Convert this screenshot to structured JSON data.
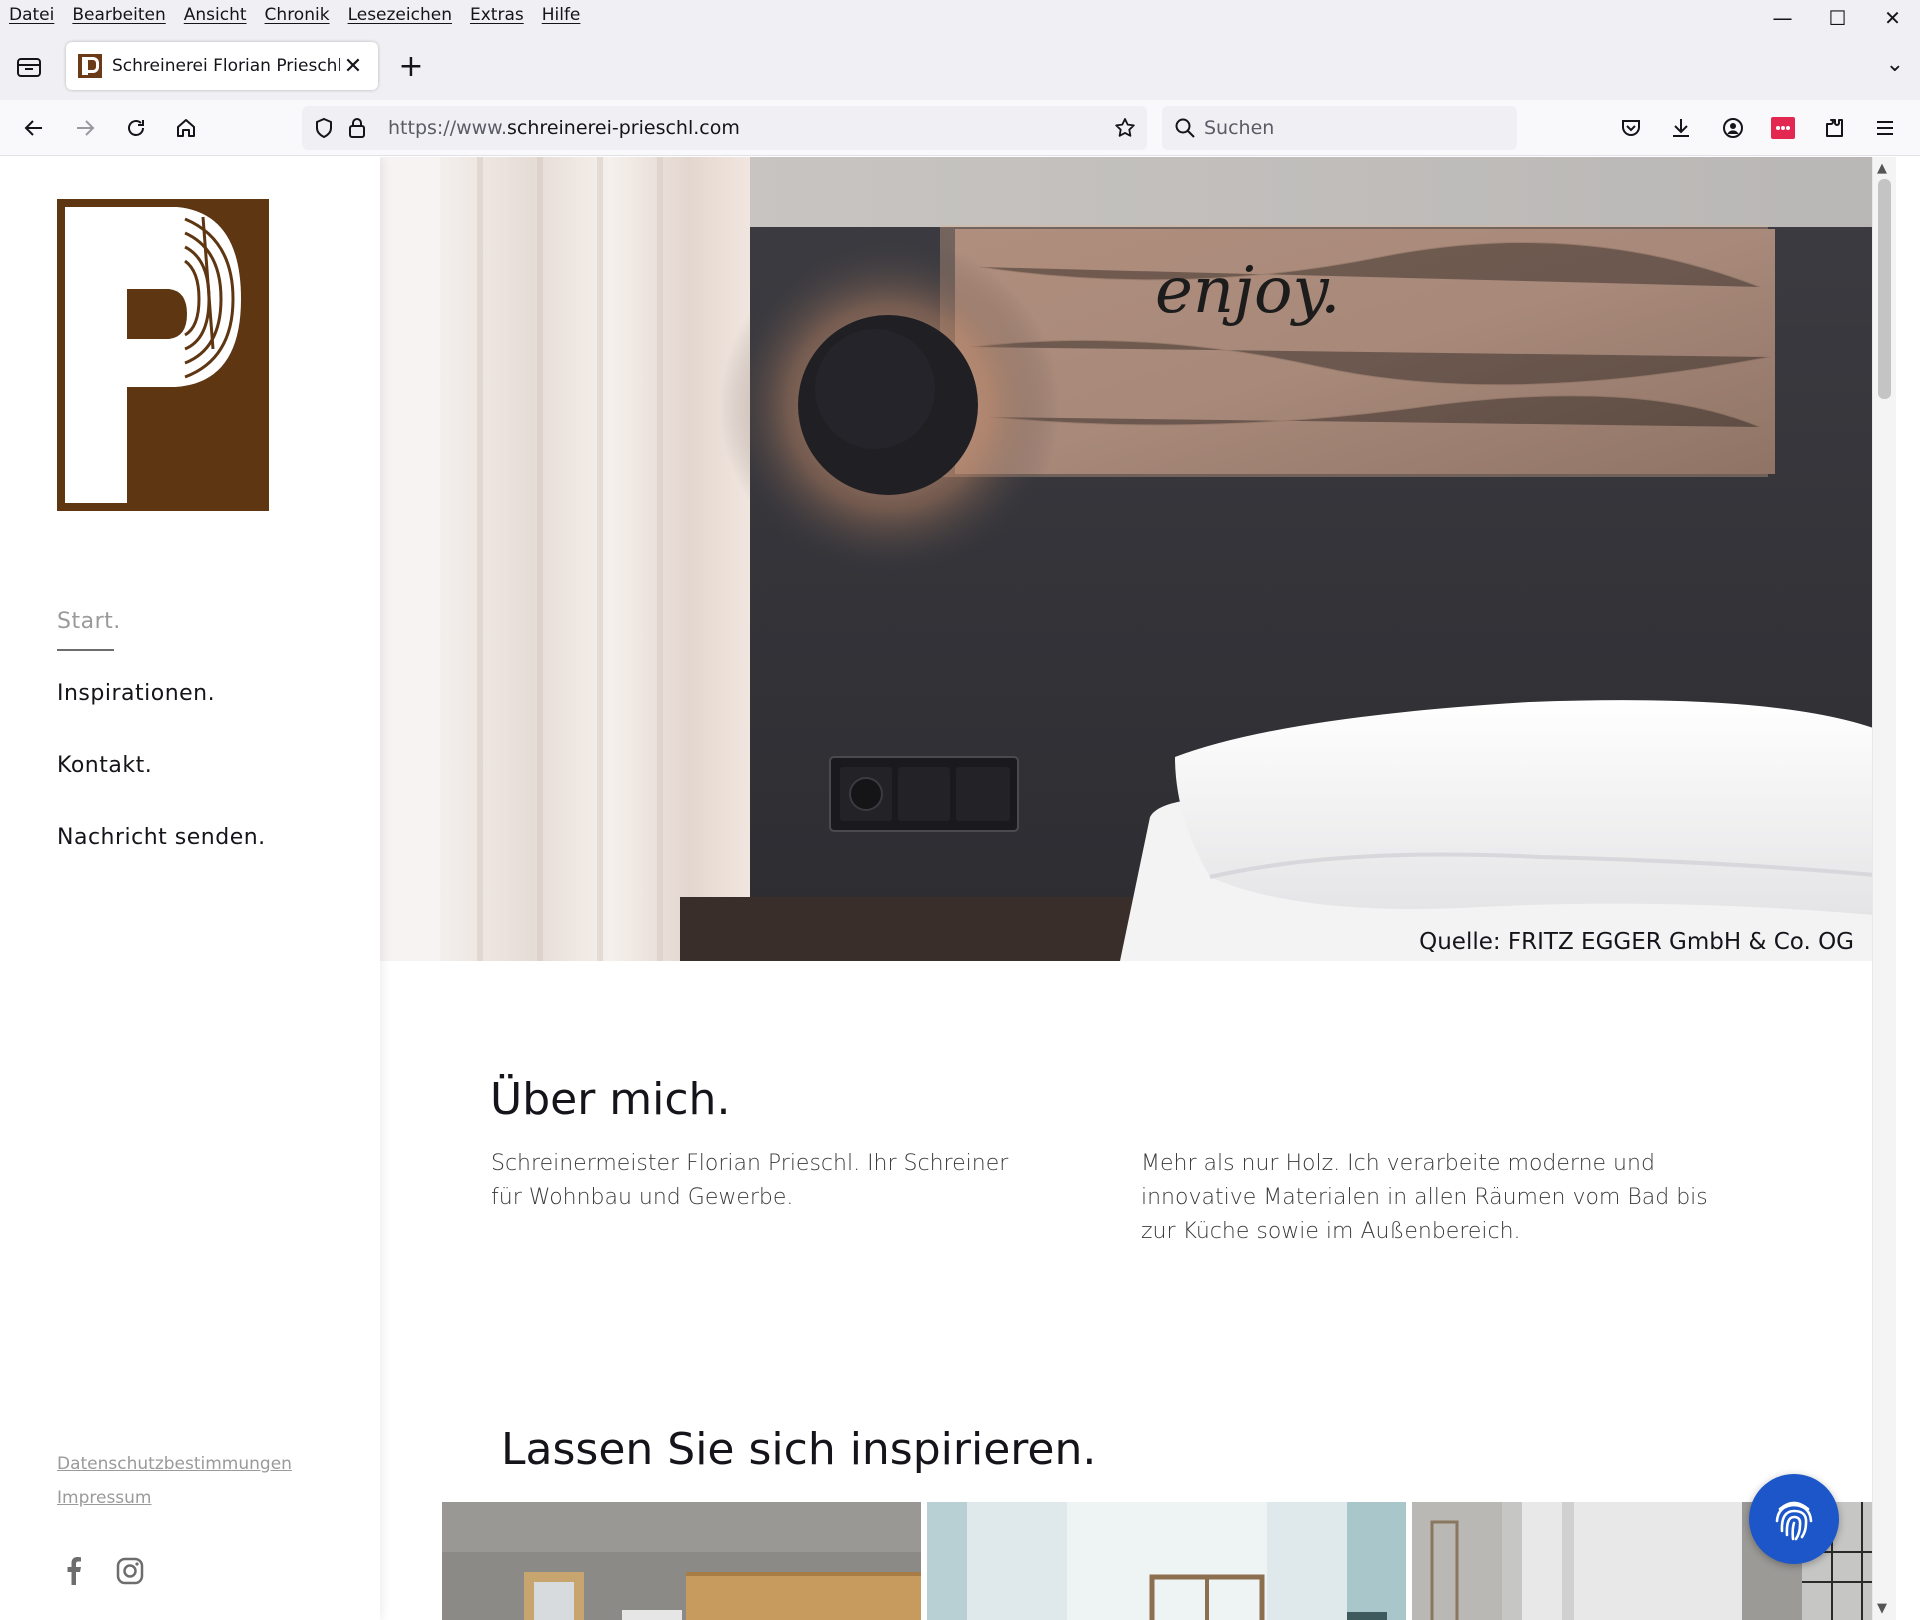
{
  "menubar": {
    "items": [
      "Datei",
      "Bearbeiten",
      "Ansicht",
      "Chronik",
      "Lesezeichen",
      "Extras",
      "Hilfe"
    ]
  },
  "window_controls": {
    "minimize": "—",
    "maximize": "☐",
    "close": "✕"
  },
  "tab": {
    "title": "Schreinerei Florian Prieschl",
    "close": "✕"
  },
  "new_tab": "+",
  "tabs_overflow": "⌄",
  "urlbar": {
    "scheme": "https://www.",
    "host": "schreinerei-prieschl.com"
  },
  "searchbar": {
    "placeholder": "Suchen"
  },
  "sidebar": {
    "nav": [
      {
        "label": "Start.",
        "active": true
      },
      {
        "label": "Inspirationen."
      },
      {
        "label": "Kontakt."
      },
      {
        "label": "Nachricht senden."
      }
    ],
    "legal": [
      "Datenschutzbestimmungen",
      "Impressum"
    ],
    "social": [
      "facebook-icon",
      "instagram-icon"
    ]
  },
  "hero": {
    "caption": "Quelle: FRITZ EGGER GmbH & Co. OG",
    "headboard_text": "enjoy."
  },
  "about": {
    "title": "Über mich.",
    "col1": "Schreinermeister Florian Prieschl. Ihr Schreiner für Wohnbau und Gewerbe.",
    "col2": "Mehr als nur Holz. Ich verarbeite moderne und innovative Materialen in allen Räumen vom Bad bis zur Küche sowie im Außenbereich."
  },
  "inspire": {
    "title": "Lassen Sie sich inspirieren."
  },
  "colors": {
    "brand_brown": "#5e3612",
    "cookie_blue": "#1c56c9",
    "chrome_bg": "#f0f0f4",
    "addon_red": "#e22850"
  }
}
